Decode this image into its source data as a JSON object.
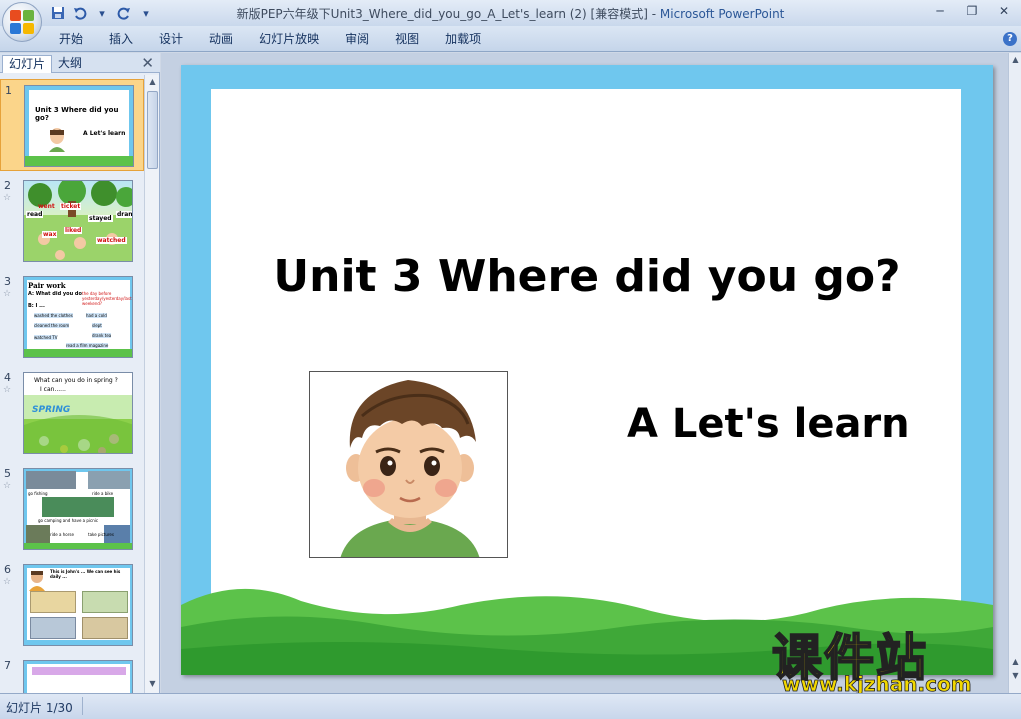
{
  "window": {
    "title": "新版PEP六年级下Unit3_Where_did_you_go_A_Let's_learn (2) [兼容模式] - ",
    "app_name": "Microsoft PowerPoint"
  },
  "ribbon": {
    "tabs": [
      "开始",
      "插入",
      "设计",
      "动画",
      "幻灯片放映",
      "审阅",
      "视图",
      "加载项"
    ]
  },
  "panel": {
    "tab_slides": "幻灯片",
    "tab_outline": "大纲",
    "thumbnails": [
      {
        "num": "1",
        "title": "Unit 3 Where did you go?",
        "sub": "A Let's learn"
      },
      {
        "num": "2",
        "words": [
          "went",
          "ticket",
          "stayed",
          "dran",
          "read",
          "wax",
          "liked",
          "watched"
        ]
      },
      {
        "num": "3",
        "title": "Pair work",
        "line1": "A: What did you do",
        "line2": "the day before yesterday/yesterday/last weekend?",
        "line3": "B: I ...",
        "items": [
          "washed the clothes",
          "had a cold",
          "cleaned the room",
          "slept",
          "watched TV",
          "drank tea",
          "read a film magazine"
        ]
      },
      {
        "num": "4",
        "question": "What can you do in spring ?",
        "answer": "I can......",
        "sign": "SPRING"
      },
      {
        "num": "5",
        "items": [
          "go fishing",
          "ride a bike",
          "go camping and have a picnic",
          "ride a horse",
          "take pictures"
        ]
      },
      {
        "num": "6",
        "caption": "This is John's ... We can see his daily ..."
      },
      {
        "num": "7"
      }
    ]
  },
  "slide": {
    "title": "Unit 3 Where did you go?",
    "subtitle": "A Let's learn"
  },
  "watermark": {
    "cn": "课件站",
    "url": "www.kjzhan.com"
  },
  "status": {
    "slide_counter": "幻灯片 1/30"
  }
}
